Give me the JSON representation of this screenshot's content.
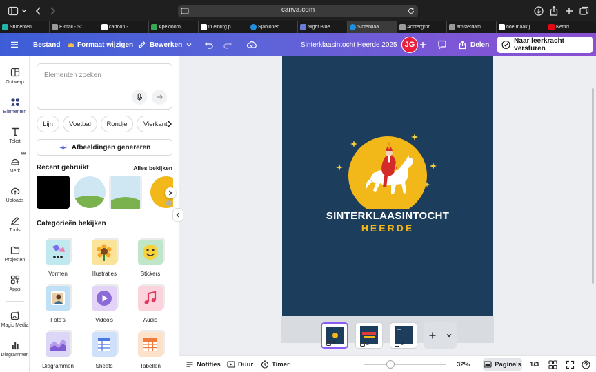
{
  "browser": {
    "url": "canva.com",
    "tabs": [
      {
        "label": "Studenten...",
        "color": "#1fb5a8"
      },
      {
        "label": "E-mail - St...",
        "color": "#9a9a9a"
      },
      {
        "label": "cartoon - ...",
        "color": "#ffffff"
      },
      {
        "label": "Apeldoorn,...",
        "color": "#34a853"
      },
      {
        "label": "in elburg p...",
        "color": "#ffffff"
      },
      {
        "label": "Sjablonen...",
        "color": "#1f8fe0"
      },
      {
        "label": "Night Blue...",
        "color": "#6b7bd8"
      },
      {
        "label": "Sinterklaa...",
        "color": "#1f8fe0"
      },
      {
        "label": "Achtergron...",
        "color": "#9a9a9a"
      },
      {
        "label": "amsterdam...",
        "color": "#9a9a9a"
      },
      {
        "label": "hoe maak j...",
        "color": "#ffffff"
      },
      {
        "label": "Netflix",
        "color": "#e50914"
      }
    ]
  },
  "toolbar": {
    "file": "Bestand",
    "resize": "Formaat wijzigen",
    "edit": "Bewerken",
    "doc_title": "Sinterklaasintocht Heerde 2025",
    "avatar": "JG",
    "share": "Delen",
    "submit": "Naar leerkracht versturen"
  },
  "rail": [
    {
      "label": "Ontwerp",
      "icon": "layout-icon"
    },
    {
      "label": "Elementen",
      "icon": "elements-icon"
    },
    {
      "label": "Tekst",
      "icon": "text-icon"
    },
    {
      "label": "Merk",
      "icon": "brand-icon"
    },
    {
      "label": "Uploads",
      "icon": "upload-icon"
    },
    {
      "label": "Tools",
      "icon": "tools-icon"
    },
    {
      "label": "Projecten",
      "icon": "folder-icon"
    },
    {
      "label": "Apps",
      "icon": "apps-icon"
    },
    {
      "label": "Magic Media",
      "icon": "magic-media-icon"
    },
    {
      "label": "Diagrammen",
      "icon": "charts-icon"
    }
  ],
  "panel": {
    "search_placeholder": "Elementen zoeken",
    "chips": [
      "Lijn",
      "Voetbal",
      "Rondje",
      "Vierkant"
    ],
    "generate": "Afbeeldingen genereren",
    "recent_title": "Recent gebruikt",
    "see_all": "Alles bekijken",
    "categories_title": "Categorieën bekijken",
    "categories": [
      "Vormen",
      "Illustraties",
      "Stickers",
      "Foto's",
      "Video's",
      "Audio",
      "Diagrammen",
      "Sheets",
      "Tabellen"
    ]
  },
  "design": {
    "line1": "SINTERKLAASINTOCHT",
    "line2": "HEERDE"
  },
  "pages": [
    "1",
    "2",
    "3"
  ],
  "bottom": {
    "notes": "Notities",
    "duration": "Duur",
    "timer": "Timer",
    "zoom": "32%",
    "pages": "Pagina's",
    "page_count": "1/3"
  },
  "zoom_level": 0.32
}
